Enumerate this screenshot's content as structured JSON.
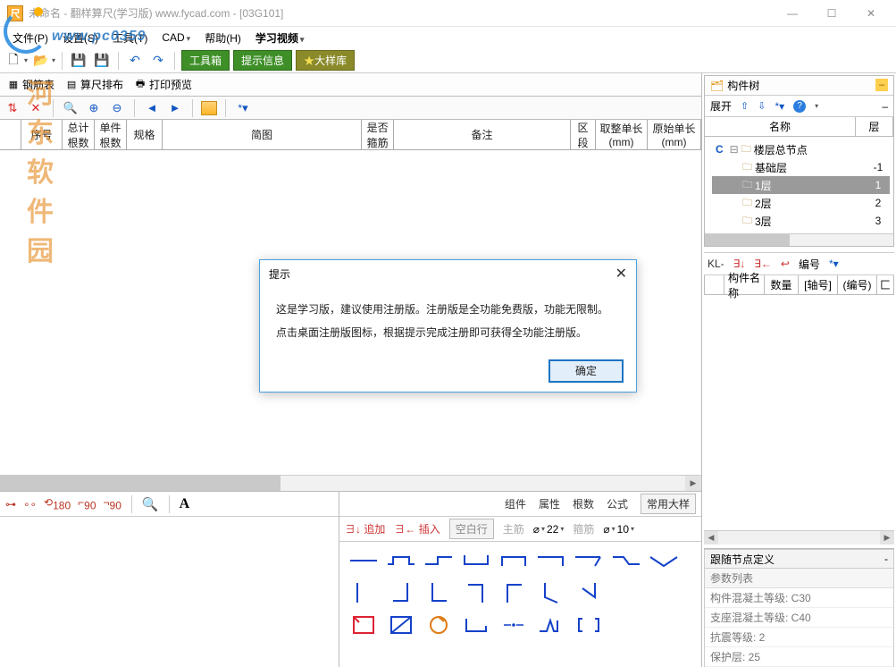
{
  "title": "未命名 - 翻样算尺(学习版) www.fycad.com - [03G101]",
  "window": {
    "min": "—",
    "max": "☐",
    "close": "✕"
  },
  "watermark": {
    "url": "www.pc0359",
    "site": "河东软件园"
  },
  "menu": {
    "file": "文件(P)",
    "settings": "设置(S)",
    "tools": "工具(T)",
    "cad": "CAD",
    "help": "帮助(H)",
    "video": "学习视频"
  },
  "toolbar": {
    "greenBtns": [
      "工具箱",
      "提示信息"
    ],
    "oliveBtn": "大样库"
  },
  "subtabs": {
    "rebar": "钢筋表",
    "layout": "算尺排布",
    "preview": "打印预览"
  },
  "toolrow": {
    "star": "*"
  },
  "table": {
    "cols": {
      "seq": "序号",
      "totalN": "总计\n根数",
      "singleN": "单件\n根数",
      "spec": "规格",
      "diagram": "简图",
      "stirrup": "是否\n箍筋",
      "remark": "备注",
      "section": "区\n段",
      "trimlen": "取整单长\n(mm)",
      "origlen": "原始单长\n(mm)"
    }
  },
  "lowerLeft": {
    "icons": {
      "n180": "180",
      "n90a": "90",
      "n90b": "90"
    }
  },
  "lowerRightTabs": {
    "comp": "组件",
    "attr": "属性",
    "count": "根数",
    "formula": "公式",
    "preset": "常用大样"
  },
  "insertBar": {
    "append": "追加",
    "insert": "插入",
    "blank": "空白行",
    "mainbar": "主筋",
    "mainVal": "22",
    "stirrup": "箍筋",
    "stirVal": "10"
  },
  "rightPanel": {
    "title": "构件树",
    "expand": "展开",
    "cols": {
      "name": "名称",
      "floor": "层"
    },
    "tree": {
      "root": "楼层总节点",
      "items": [
        {
          "label": "基础层",
          "floor": "-1"
        },
        {
          "label": "1层",
          "floor": "1",
          "selected": true
        },
        {
          "label": "2层",
          "floor": "2"
        },
        {
          "label": "3层",
          "floor": "3"
        }
      ]
    }
  },
  "kl": {
    "label": "KL-",
    "numLabel": "编号",
    "star": "*"
  },
  "klCols": {
    "name": "构件名称",
    "qty": "数量",
    "axis": "[轴号]",
    "no": "(编号)",
    "ext": "匚"
  },
  "follow": {
    "title": "跟随节点定义",
    "sub": "参数列表",
    "rows": [
      "构件混凝土等级: C30",
      "支座混凝土等级: C40",
      "抗震等级: 2",
      "保护层: 25"
    ]
  },
  "dialog": {
    "title": "提示",
    "line1": "这是学习版，建议使用注册版。注册版是全功能免费版，功能无限制。",
    "line2": "点击桌面注册版图标，根据提示完成注册即可获得全功能注册版。",
    "ok": "确定"
  }
}
